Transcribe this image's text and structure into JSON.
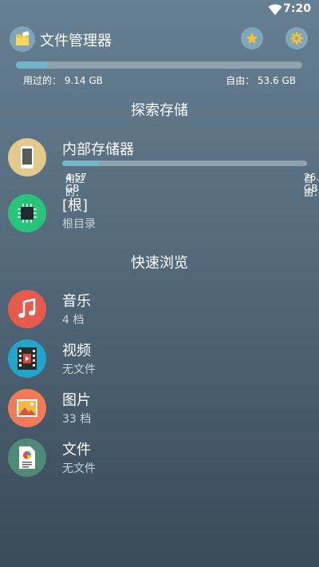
{
  "status_bar": {
    "time": "7:20"
  },
  "header": {
    "title": "文件管理器"
  },
  "overall_usage": {
    "used_label": "用过的：",
    "used_value": "9.14 GB",
    "free_label": "自由：",
    "free_value": "53.6 GB",
    "used_fraction": 0.11
  },
  "explore": {
    "title": "探索存储",
    "internal": {
      "title": "内部存储器",
      "used_label": "用过的：",
      "used_value": "4.57 GB",
      "free_label": "自由：",
      "free_value": "26.8 GB",
      "used_fraction": 0.15
    },
    "root": {
      "title": "[根]",
      "subtitle": "根目录"
    }
  },
  "quick_browse": {
    "title": "快速浏览",
    "items": [
      {
        "title": "音乐",
        "subtitle": "4 档",
        "icon": "music-icon",
        "color": "#e65b4e"
      },
      {
        "title": "视频",
        "subtitle": "无文件",
        "icon": "film-icon",
        "color": "#1fa6c9"
      },
      {
        "title": "图片",
        "subtitle": "33 档",
        "icon": "image-icon",
        "color": "#f17a57"
      },
      {
        "title": "文件",
        "subtitle": "无文件",
        "icon": "document-icon",
        "color": "#4f8a76"
      }
    ]
  },
  "colors": {
    "accent": "#6fb6c9",
    "storage_icon_bg": "#e3c98b",
    "root_icon_bg": "#27c47a"
  }
}
